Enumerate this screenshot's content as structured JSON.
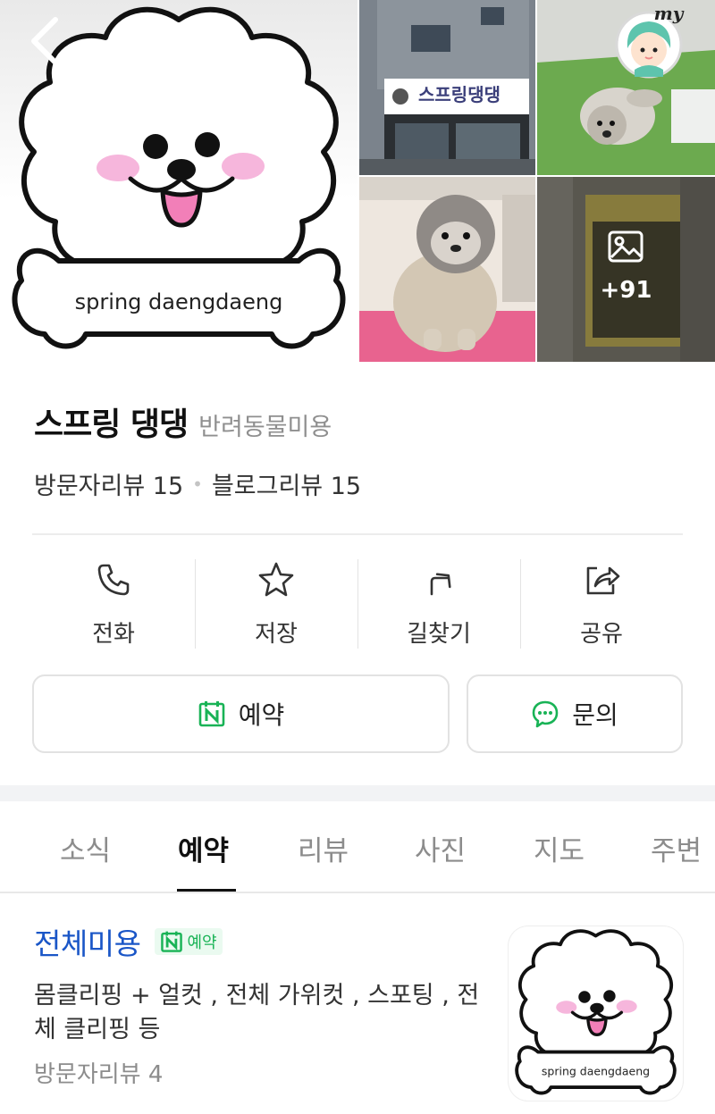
{
  "place": {
    "name": "스프링 댕댕",
    "category": "반려동물미용",
    "visitor_reviews": "방문자리뷰 15",
    "blog_reviews": "블로그리뷰 15",
    "separator": "•"
  },
  "photos": {
    "main_logo_text": "spring daengdaeng",
    "shop_sign_text": "스프링댕댕",
    "more_count": "+91",
    "my_label": "my"
  },
  "actions": [
    {
      "label": "전화",
      "icon": "phone-icon"
    },
    {
      "label": "저장",
      "icon": "star-icon"
    },
    {
      "label": "길찾기",
      "icon": "directions-icon"
    },
    {
      "label": "공유",
      "icon": "share-icon"
    }
  ],
  "buttons": {
    "booking": "예약",
    "inquiry": "문의"
  },
  "tabs": [
    "소식",
    "예약",
    "리뷰",
    "사진",
    "지도",
    "주변"
  ],
  "active_tab": "예약",
  "menu_item": {
    "title": "전체미용",
    "badge": "예약",
    "description": "몸클리핑 + 얼컷 , 전체 가위컷 , 스포팅 , 전체 클리핑 등",
    "reviews": "방문자리뷰 4",
    "thumb_text": "spring daengdaeng"
  },
  "colors": {
    "naver_green": "#19b356",
    "link_blue": "#1a56c7",
    "cheek_pink": "#f6b6dc",
    "tongue_pink": "#f27fb8"
  }
}
